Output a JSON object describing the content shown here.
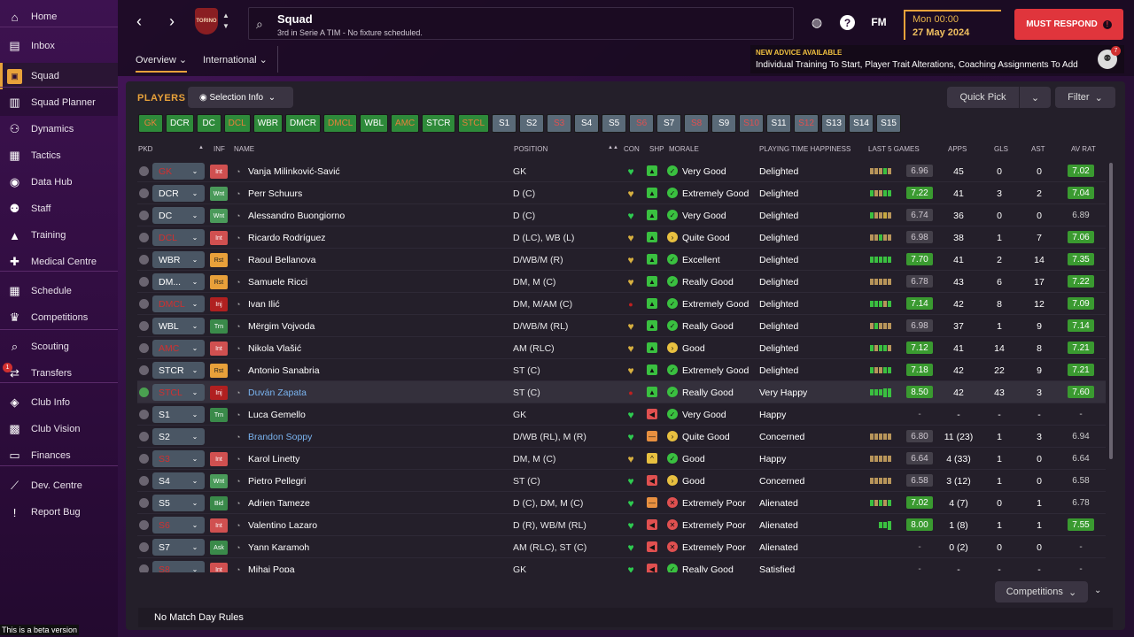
{
  "sidebar": {
    "items": [
      {
        "label": "Home",
        "icon": "home-icon",
        "glyph": "⌂"
      },
      {
        "label": "Inbox",
        "icon": "inbox-icon",
        "glyph": "▤"
      },
      {
        "label": "Squad",
        "icon": "shirt-icon",
        "glyph": "▣"
      },
      {
        "label": "Squad Planner",
        "icon": "clipboard-icon",
        "glyph": "▥"
      },
      {
        "label": "Dynamics",
        "icon": "people-icon",
        "glyph": "⚇"
      },
      {
        "label": "Tactics",
        "icon": "tactics-icon",
        "glyph": "▦"
      },
      {
        "label": "Data Hub",
        "icon": "data-hub-icon",
        "glyph": "◉"
      },
      {
        "label": "Staff",
        "icon": "staff-icon",
        "glyph": "⚉"
      },
      {
        "label": "Training",
        "icon": "training-icon",
        "glyph": "▲"
      },
      {
        "label": "Medical Centre",
        "icon": "medical-icon",
        "glyph": "✚"
      },
      {
        "label": "Schedule",
        "icon": "calendar-icon",
        "glyph": "▦"
      },
      {
        "label": "Competitions",
        "icon": "trophy-icon",
        "glyph": "♛"
      },
      {
        "label": "Scouting",
        "icon": "scouting-icon",
        "glyph": "⌕"
      },
      {
        "label": "Transfers",
        "icon": "transfers-icon",
        "glyph": "⇄",
        "badge": "1"
      },
      {
        "label": "Club Info",
        "icon": "shield-icon",
        "glyph": "◈"
      },
      {
        "label": "Club Vision",
        "icon": "briefcase-icon",
        "glyph": "▩"
      },
      {
        "label": "Finances",
        "icon": "finances-icon",
        "glyph": "▭"
      },
      {
        "label": "Dev. Centre",
        "icon": "dev-centre-icon",
        "glyph": "⟋"
      },
      {
        "label": "Report Bug",
        "icon": "bug-icon",
        "glyph": "!"
      }
    ],
    "beta": "This is a beta version"
  },
  "header": {
    "title": "Squad",
    "subtitle": "3rd in Serie A TIM - No fixture scheduled.",
    "crest": "TORINO",
    "date_day": "Mon 00:00",
    "date": "27 May 2024",
    "must_respond": "MUST RESPOND",
    "fm": "FM"
  },
  "tabs": {
    "overview": "Overview",
    "international": "International"
  },
  "advice": {
    "heading": "NEW ADVICE AVAILABLE",
    "text": "Individual Training To Start, Player Trait Alterations, Coaching Assignments To Add",
    "count": "7"
  },
  "panel": {
    "title": "PLAYERS",
    "selection_info": "Selection Info",
    "quick_pick": "Quick Pick",
    "filter": "Filter",
    "competitions": "Competitions",
    "rules": "No Match Day Rules"
  },
  "chips": [
    {
      "l": "GK",
      "s": "warn"
    },
    {
      "l": "DCR",
      "s": "ok"
    },
    {
      "l": "DC",
      "s": "ok"
    },
    {
      "l": "DCL",
      "s": "warn"
    },
    {
      "l": "WBR",
      "s": "ok"
    },
    {
      "l": "DMCR",
      "s": "ok"
    },
    {
      "l": "DMCL",
      "s": "warn"
    },
    {
      "l": "WBL",
      "s": "ok"
    },
    {
      "l": "AMC",
      "s": "warn"
    },
    {
      "l": "STCR",
      "s": "ok"
    },
    {
      "l": "STCL",
      "s": "warn"
    },
    {
      "l": "S1",
      "s": "sub"
    },
    {
      "l": "S2",
      "s": "sub"
    },
    {
      "l": "S3",
      "s": "subw"
    },
    {
      "l": "S4",
      "s": "sub"
    },
    {
      "l": "S5",
      "s": "sub"
    },
    {
      "l": "S6",
      "s": "subw"
    },
    {
      "l": "S7",
      "s": "sub"
    },
    {
      "l": "S8",
      "s": "subw"
    },
    {
      "l": "S9",
      "s": "sub"
    },
    {
      "l": "S10",
      "s": "subw"
    },
    {
      "l": "S11",
      "s": "sub"
    },
    {
      "l": "S12",
      "s": "subw"
    },
    {
      "l": "S13",
      "s": "sub"
    },
    {
      "l": "S14",
      "s": "sub"
    },
    {
      "l": "S15",
      "s": "sub"
    }
  ],
  "columns": {
    "pkd": "PKD",
    "inf": "INF",
    "name": "NAME",
    "position": "POSITION",
    "con": "CON",
    "shp": "SHP",
    "morale": "MORALE",
    "pth": "PLAYING TIME HAPPINESS",
    "last5": "LAST 5 GAMES",
    "apps": "APPS",
    "gls": "GLS",
    "ast": "AST",
    "avrat": "AV RAT"
  },
  "players": [
    {
      "pkd": false,
      "pos": "GK",
      "pb": true,
      "inf": "Int",
      "name": "Vanja Milinković-Savić",
      "position": "GK",
      "con": "g",
      "shp": "g",
      "mi": "g",
      "morale": "Very Good",
      "pth": "Delighted",
      "l5": "pppgp",
      "lrat": "6.96",
      "lr": "n",
      "apps": "45",
      "gls": "0",
      "ast": "0",
      "avr": "7.02",
      "ar": "g"
    },
    {
      "pkd": false,
      "pos": "DCR",
      "pb": false,
      "inf": "Wnt",
      "name": "Perr Schuurs",
      "position": "D (C)",
      "con": "y",
      "shp": "g",
      "mi": "g",
      "morale": "Extremely Good",
      "pth": "Delighted",
      "l5": "gppgg",
      "lrat": "7.22",
      "lr": "g",
      "apps": "41",
      "gls": "3",
      "ast": "2",
      "avr": "7.04",
      "ar": "g"
    },
    {
      "pkd": false,
      "pos": "DC",
      "pb": false,
      "inf": "Wnt",
      "name": "Alessandro Buongiorno",
      "position": "D (C)",
      "con": "g",
      "shp": "g",
      "mi": "g",
      "morale": "Very Good",
      "pth": "Delighted",
      "l5": "gppyp",
      "lrat": "6.74",
      "lr": "n",
      "apps": "36",
      "gls": "0",
      "ast": "0",
      "avr": "6.89",
      "ar": "n"
    },
    {
      "pkd": false,
      "pos": "DCL",
      "pb": true,
      "inf": "Int",
      "name": "Ricardo Rodríguez",
      "position": "D (LC), WB (L)",
      "con": "y",
      "shp": "g",
      "mi": "y",
      "morale": "Quite Good",
      "pth": "Delighted",
      "l5": "ppgpp",
      "lrat": "6.98",
      "lr": "n",
      "apps": "38",
      "gls": "1",
      "ast": "7",
      "avr": "7.06",
      "ar": "g"
    },
    {
      "pkd": false,
      "pos": "WBR",
      "pb": false,
      "inf": "Rst",
      "name": "Raoul Bellanova",
      "position": "D/WB/M (R)",
      "con": "y",
      "shp": "g",
      "mi": "g",
      "morale": "Excellent",
      "pth": "Delighted",
      "l5": "ggggg",
      "lrat": "7.70",
      "lr": "g",
      "apps": "41",
      "gls": "2",
      "ast": "14",
      "avr": "7.35",
      "ar": "g"
    },
    {
      "pkd": false,
      "pos": "DM...",
      "pb": false,
      "inf": "Rst",
      "name": "Samuele Ricci",
      "position": "DM, M (C)",
      "con": "y",
      "shp": "g",
      "mi": "g",
      "morale": "Really Good",
      "pth": "Delighted",
      "l5": "ppppp",
      "lrat": "6.78",
      "lr": "n",
      "apps": "43",
      "gls": "6",
      "ast": "17",
      "avr": "7.22",
      "ar": "g"
    },
    {
      "pkd": false,
      "pos": "DMCL",
      "pb": true,
      "inf": "Inj",
      "name": "Ivan Ilić",
      "position": "DM, M/AM (C)",
      "con": "r",
      "shp": "g",
      "mi": "g",
      "morale": "Extremely Good",
      "pth": "Delighted",
      "l5": "gggpg",
      "lrat": "7.14",
      "lr": "g",
      "apps": "42",
      "gls": "8",
      "ast": "12",
      "avr": "7.09",
      "ar": "g"
    },
    {
      "pkd": false,
      "pos": "WBL",
      "pb": false,
      "inf": "Trn",
      "name": "Mërgim Vojvoda",
      "position": "D/WB/M (RL)",
      "con": "y",
      "shp": "g",
      "mi": "g",
      "morale": "Really Good",
      "pth": "Delighted",
      "l5": "pgppp",
      "lrat": "6.98",
      "lr": "n",
      "apps": "37",
      "gls": "1",
      "ast": "9",
      "avr": "7.14",
      "ar": "g"
    },
    {
      "pkd": false,
      "pos": "AMC",
      "pb": true,
      "inf": "Int",
      "name": "Nikola Vlašić",
      "position": "AM (RLC)",
      "con": "y",
      "shp": "g",
      "mi": "y",
      "morale": "Good",
      "pth": "Delighted",
      "l5": "gpggp",
      "lrat": "7.12",
      "lr": "g",
      "apps": "41",
      "gls": "14",
      "ast": "8",
      "avr": "7.21",
      "ar": "g"
    },
    {
      "pkd": false,
      "pos": "STCR",
      "pb": false,
      "inf": "Rst",
      "name": "Antonio Sanabria",
      "position": "ST (C)",
      "con": "y",
      "shp": "g",
      "mi": "g",
      "morale": "Extremely Good",
      "pth": "Delighted",
      "l5": "gppgg",
      "lrat": "7.18",
      "lr": "g",
      "apps": "42",
      "gls": "22",
      "ast": "9",
      "avr": "7.21",
      "ar": "g"
    },
    {
      "pkd": true,
      "pos": "STCL",
      "pb": true,
      "inf": "Inj",
      "name": "Duván Zapata",
      "blue": true,
      "position": "ST (C)",
      "con": "r",
      "shp": "g",
      "mi": "g",
      "morale": "Really Good",
      "pth": "Very Happy",
      "l5": "gggGG",
      "lrat": "8.50",
      "lr": "g",
      "apps": "42",
      "gls": "43",
      "ast": "3",
      "avr": "7.60",
      "ar": "g",
      "sel": true
    },
    {
      "pkd": false,
      "pos": "S1",
      "pb": false,
      "inf": "Trn",
      "name": "Luca Gemello",
      "position": "GK",
      "con": "g",
      "shp": "r",
      "mi": "g",
      "morale": "Very Good",
      "pth": "Happy",
      "l5": "",
      "lrat": "-",
      "lr": "n",
      "apps": "-",
      "gls": "-",
      "ast": "-",
      "avr": "-",
      "ar": "n"
    },
    {
      "pkd": false,
      "pos": "S2",
      "pb": false,
      "inf": "none",
      "name": "Brandon Soppy",
      "blue": true,
      "position": "D/WB (RL), M (R)",
      "con": "g",
      "shp": "o",
      "mi": "y",
      "morale": "Quite Good",
      "pth": "Concerned",
      "l5": "ppppp",
      "lrat": "6.80",
      "lr": "n",
      "apps": "11 (23)",
      "gls": "1",
      "ast": "3",
      "avr": "6.94",
      "ar": "n"
    },
    {
      "pkd": false,
      "pos": "S3",
      "pb": true,
      "inf": "Int",
      "name": "Karol Linetty",
      "position": "DM, M (C)",
      "con": "y",
      "shp": "y",
      "mi": "g",
      "morale": "Good",
      "pth": "Happy",
      "l5": "ppppp",
      "lrat": "6.64",
      "lr": "n",
      "apps": "4 (33)",
      "gls": "1",
      "ast": "0",
      "avr": "6.64",
      "ar": "n"
    },
    {
      "pkd": false,
      "pos": "S4",
      "pb": false,
      "inf": "Wnt",
      "name": "Pietro Pellegri",
      "position": "ST (C)",
      "con": "g",
      "shp": "r",
      "mi": "y",
      "morale": "Good",
      "pth": "Concerned",
      "l5": "ppppp",
      "lrat": "6.58",
      "lr": "n",
      "apps": "3 (12)",
      "gls": "1",
      "ast": "0",
      "avr": "6.58",
      "ar": "n"
    },
    {
      "pkd": false,
      "pos": "S5",
      "pb": false,
      "inf": "Bid",
      "name": "Adrien Tameze",
      "position": "D (C), DM, M (C)",
      "con": "g",
      "shp": "o",
      "mi": "r",
      "morale": "Extremely Poor",
      "pth": "Alienated",
      "l5": "gpgpg",
      "lrat": "7.02",
      "lr": "g",
      "apps": "4 (7)",
      "gls": "0",
      "ast": "1",
      "avr": "6.78",
      "ar": "n"
    },
    {
      "pkd": false,
      "pos": "S6",
      "pb": true,
      "inf": "Int",
      "name": "Valentino Lazaro",
      "position": "D (R), WB/M (RL)",
      "con": "g",
      "shp": "r",
      "mi": "r",
      "morale": "Extremely Poor",
      "pth": "Alienated",
      "l5": "ggG",
      "lrat": "8.00",
      "lr": "g",
      "apps": "1 (8)",
      "gls": "1",
      "ast": "1",
      "avr": "7.55",
      "ar": "g"
    },
    {
      "pkd": false,
      "pos": "S7",
      "pb": false,
      "inf": "Ask",
      "name": "Yann Karamoh",
      "position": "AM (RLC), ST (C)",
      "con": "g",
      "shp": "r",
      "mi": "r",
      "morale": "Extremely Poor",
      "pth": "Alienated",
      "l5": "",
      "lrat": "-",
      "lr": "n",
      "apps": "0 (2)",
      "gls": "0",
      "ast": "0",
      "avr": "-",
      "ar": "n"
    },
    {
      "pkd": false,
      "pos": "S8",
      "pb": true,
      "inf": "Int",
      "name": "Mihai Popa",
      "position": "GK",
      "con": "g",
      "shp": "r",
      "mi": "g",
      "morale": "Really Good",
      "pth": "Satisfied",
      "l5": "",
      "lrat": "-",
      "lr": "n",
      "apps": "-",
      "gls": "-",
      "ast": "-",
      "avr": "-",
      "ar": "n"
    }
  ]
}
